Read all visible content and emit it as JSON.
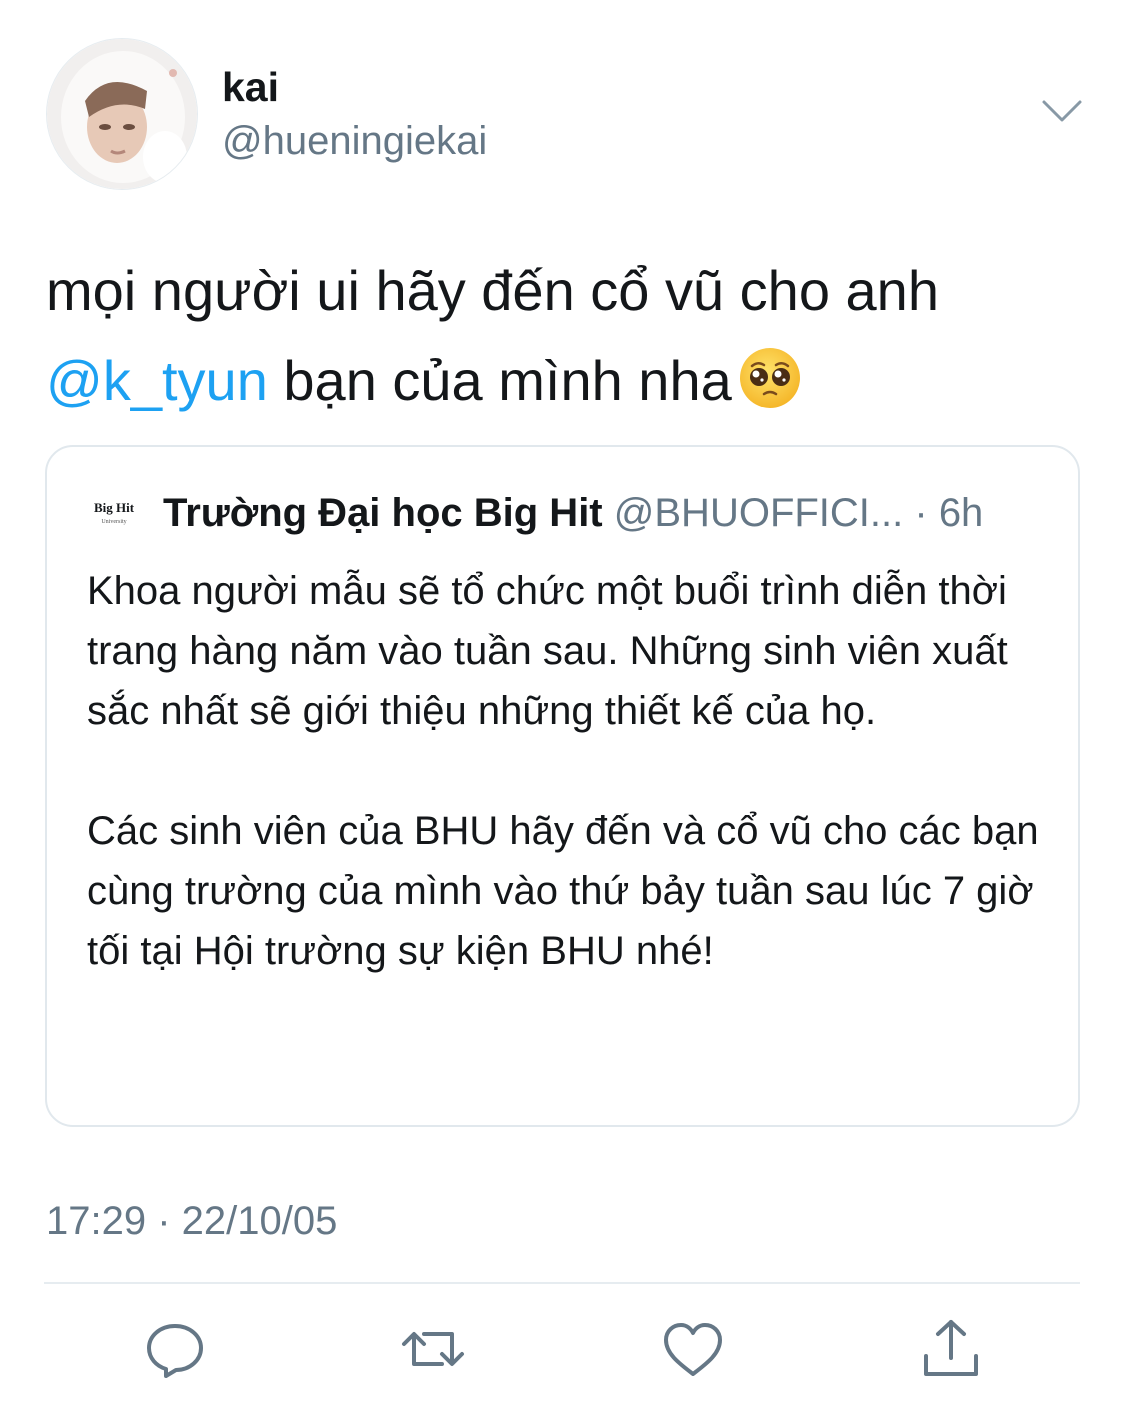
{
  "author": {
    "display_name": "kai",
    "handle": "@hueningiekai",
    "avatar_icon": "avatar-photo"
  },
  "tweet": {
    "line1": "mọi người ui hãy đến cổ vũ cho anh",
    "mention": "@k_tyun",
    "line2_rest": " bạn của mình nha",
    "emoji": "pleading-face-emoji"
  },
  "quoted_tweet": {
    "logo_text": "Big Hit",
    "logo_subtext": "University",
    "name": "Trường Đại học Big Hit",
    "handle": "@BHUOFFICI...",
    "time": " · 6h",
    "paragraph1": "Khoa người mẫu sẽ tổ chức một buổi trình diễn thời trang hàng năm vào tuần sau. Những sinh viên xuất sắc nhất sẽ giới thiệu những thiết kế của họ.",
    "paragraph2": "Các sinh viên của BHU hãy đến và cổ vũ cho các bạn cùng trường của mình vào thứ bảy tuần sau lúc 7 giờ tối tại Hội trường sự kiện BHU nhé!"
  },
  "meta": {
    "timestamp": "17:29 · 22/10/05"
  },
  "actions": [
    "reply-icon",
    "retweet-icon",
    "like-icon",
    "share-icon"
  ],
  "colors": {
    "text": "#14171a",
    "secondary": "#657786",
    "link": "#1da1f2",
    "border": "#e1e8ed"
  }
}
